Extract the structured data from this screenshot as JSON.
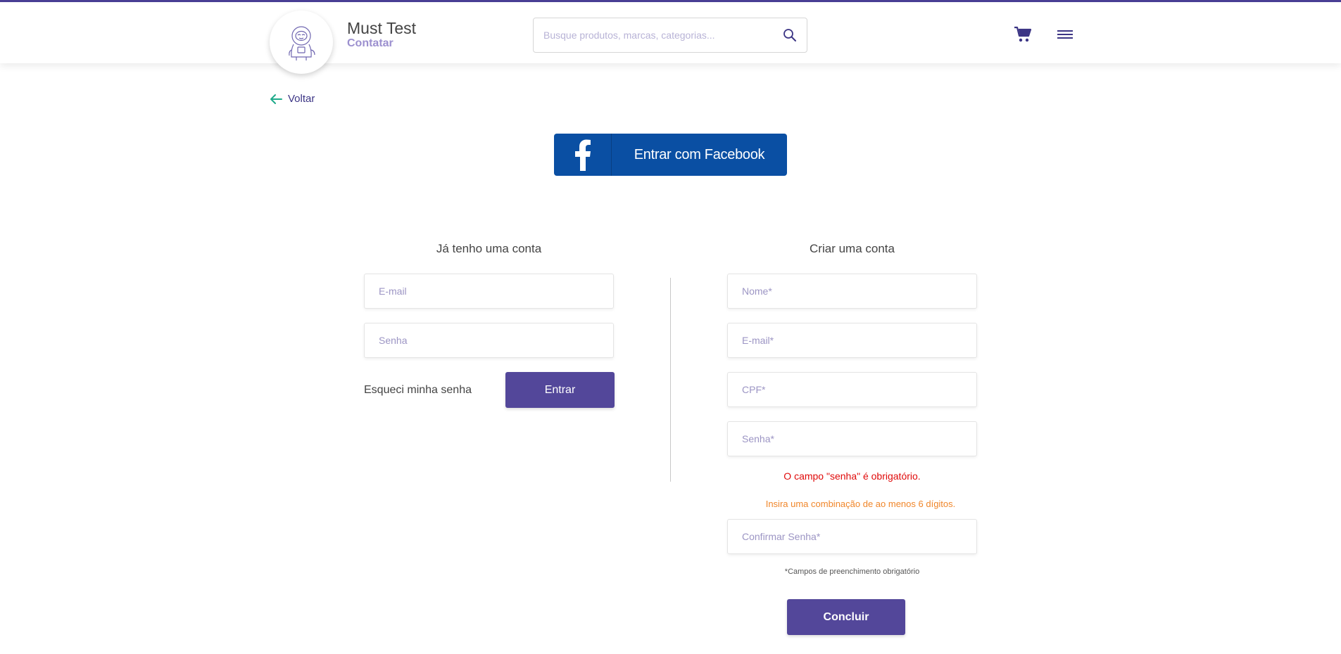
{
  "header": {
    "brand_name": "Must Test",
    "brand_sub": "Contatar",
    "search_placeholder": "Busque produtos, marcas, categorias...",
    "accent_color": "#4a3f96"
  },
  "back": {
    "label": "Voltar"
  },
  "facebook": {
    "label": "Entrar com Facebook",
    "color": "#0a4fa3"
  },
  "login": {
    "title": "Já tenho uma conta",
    "email_placeholder": "E-mail",
    "password_placeholder": "Senha",
    "forgot_label": "Esqueci minha senha",
    "submit_label": "Entrar"
  },
  "register": {
    "title": "Criar uma conta",
    "name_placeholder": "Nome*",
    "email_placeholder": "E-mail*",
    "cpf_placeholder": "CPF*",
    "password_placeholder": "Senha*",
    "password_error": "O campo \"senha\" é obrigatório.",
    "password_hint": "Insira uma combinação de ao menos 6 dígitos.",
    "confirm_placeholder": "Confirmar Senha*",
    "required_note": "*Campos de preenchimento obrigatório",
    "submit_label": "Concluir"
  }
}
